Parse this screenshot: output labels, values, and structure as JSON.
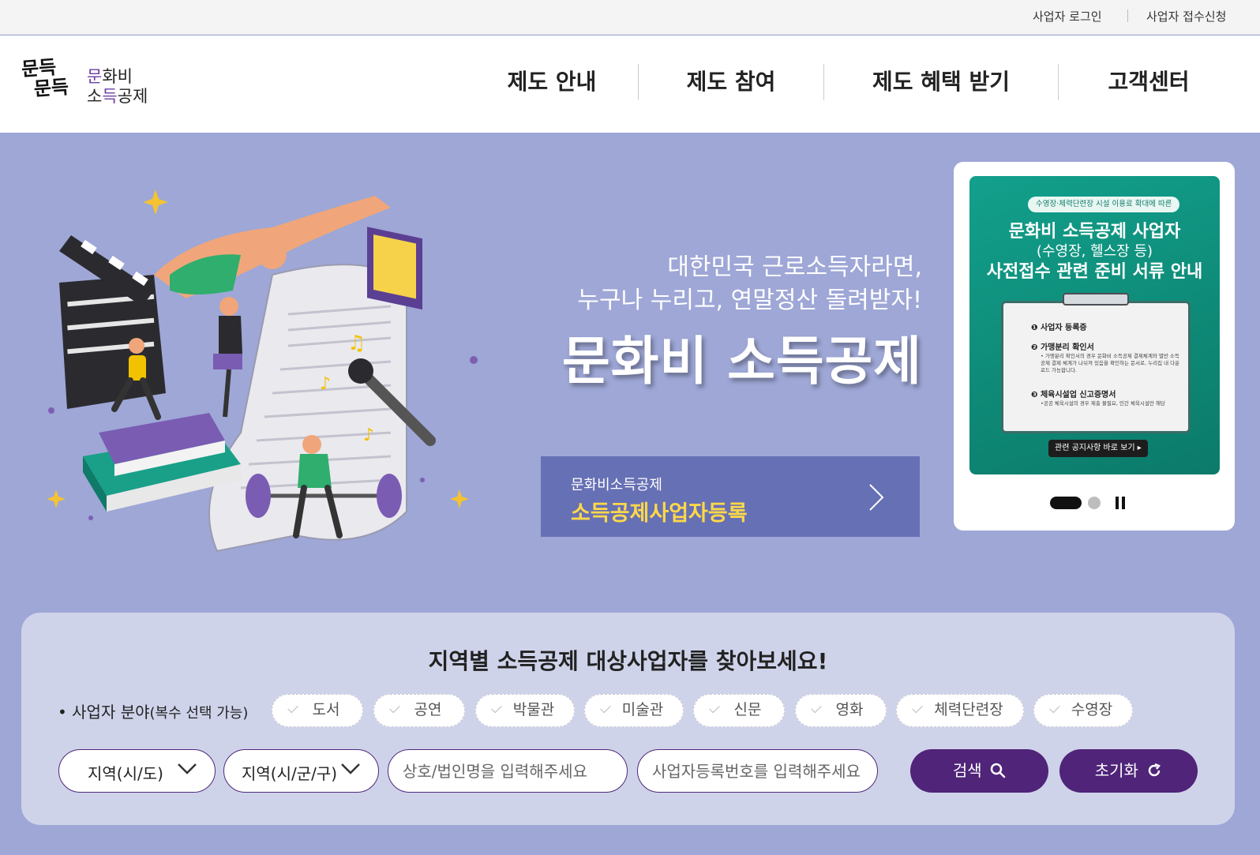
{
  "colors": {
    "hero_bg": "#9ea7d6",
    "search_bg": "#cfd3ea",
    "primary": "#4f2479",
    "accent_yellow": "#ffd84a",
    "register_bg": "#6670b4",
    "banner_bg": "#12a08c"
  },
  "util": {
    "login": "사업자 로그인",
    "apply": "사업자 접수신청"
  },
  "logo": {
    "hand_line1": "문득",
    "hand_line2": "문득",
    "word_line1_accent": "문",
    "word_line1_rest": "화비",
    "word_line2_a": "소",
    "word_line2_accent": "득",
    "word_line2_rest": "공제"
  },
  "nav": [
    "제도 안내",
    "제도 참여",
    "제도 혜택 받기",
    "고객센터"
  ],
  "hero": {
    "line1": "대한민국 근로소득자라면,",
    "line2": "누구나 누리고, 연말정산 돌려받자!",
    "headline": "문화비 소득공제",
    "register_sub": "문화비소득공제",
    "register_main": "소득공제사업자등록",
    "register_icon": "chevron-right-icon"
  },
  "banner": {
    "pill": "수영장·체력단련장 시설 이용료 확대에 따른",
    "title1": "문화비 소득공제 사업자",
    "title2": "(수영장, 헬스장 등)",
    "title3": "사전접수 관련 준비 서류 안내",
    "item1": "❶ 사업자 등록증",
    "item2": "❷ 가맹분리 확인서",
    "item2_desc": "• 가맹분리 확인서의 경우 문화비 소득공제 결제체계와 별반 소득공제 결제 체계가 나뉘져 있음을 확인하는 문서로, 누리집 내 다운로드 가능합니다.",
    "item3": "❸ 체육시설업 신고증명서",
    "item3_desc": "•공공 체육시설의 경우 제출 불필요, 민간 체육시설만 해당",
    "button": "관련 공지사항 바로 보기 ▸",
    "slide_current": 1,
    "slide_total": 2
  },
  "search": {
    "title": "지역별 소득공제 대상사업자를 찾아보세요!",
    "category_label": "• 사업자 분야",
    "category_hint": "(복수 선택 가능)",
    "categories": [
      "도서",
      "공연",
      "박물관",
      "미술관",
      "신문",
      "영화",
      "체력단련장",
      "수영장"
    ],
    "sido": "지역(시/도)",
    "sigungu": "지역(시/군/구)",
    "name_placeholder": "상호/법인명을 입력해주세요",
    "bizno_placeholder": "사업자등록번호를 입력해주세요",
    "search_btn": "검색",
    "reset_btn": "초기화"
  }
}
